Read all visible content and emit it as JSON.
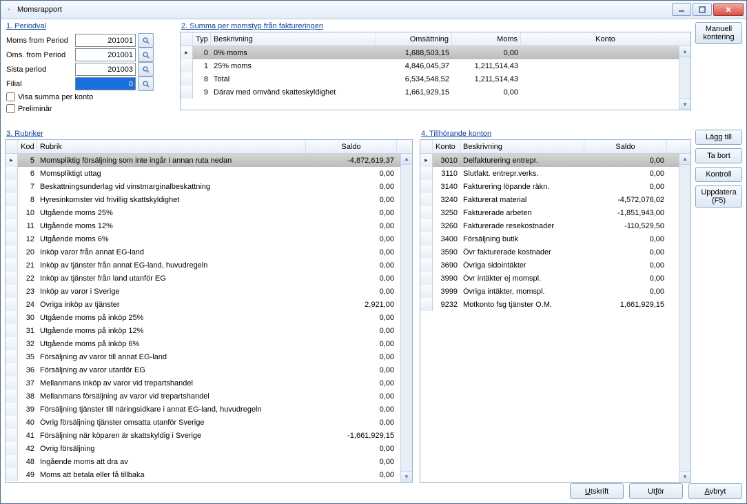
{
  "window": {
    "title": "Momsrapport"
  },
  "periodval": {
    "title": "1. Periodval",
    "moms_from_label": "Moms from Period",
    "moms_from": "201001",
    "oms_from_label": "Oms. from Period",
    "oms_from": "201001",
    "sista_label": "Sista period",
    "sista": "201003",
    "filial_label": "Filial",
    "filial": "0",
    "chk_visa": "Visa summa per konto",
    "chk_prelim": "Preliminär"
  },
  "summa": {
    "title": "2. Summa per momstyp från faktureringen",
    "head": {
      "typ": "Typ",
      "beskr": "Beskrivning",
      "oms": "Omsättning",
      "moms": "Moms",
      "konto": "Konto"
    },
    "rows": [
      {
        "typ": "0",
        "beskr": "0% moms",
        "oms": "1,688,503,15",
        "moms": "0,00",
        "sel": true
      },
      {
        "typ": "1",
        "beskr": "25% moms",
        "oms": "4,846,045,37",
        "moms": "1,211,514,43"
      },
      {
        "typ": "8",
        "beskr": "Total",
        "oms": "6,534,548,52",
        "moms": "1,211,514,43"
      },
      {
        "typ": "9",
        "beskr": "Därav med omvänd skatteskyldighet",
        "oms": "1,661,929,15",
        "moms": "0,00"
      }
    ]
  },
  "manuell": "Manuell\nkontering",
  "rubriker": {
    "title": "3. Rubriker",
    "head": {
      "kod": "Kod",
      "rubrik": "Rubrik",
      "saldo": "Saldo"
    },
    "rows": [
      {
        "kod": "5",
        "rubrik": "Momspliktig försäljning som inte ingår i annan ruta nedan",
        "saldo": "-4,872,619,37",
        "sel": true
      },
      {
        "kod": "6",
        "rubrik": "Momspliktigt uttag",
        "saldo": "0,00"
      },
      {
        "kod": "7",
        "rubrik": "Beskattningsunderlag vid vinstmarginalbeskattning",
        "saldo": "0,00"
      },
      {
        "kod": "8",
        "rubrik": "Hyresinkomster vid frivillig skattskyldighet",
        "saldo": "0,00"
      },
      {
        "kod": "10",
        "rubrik": "Utgående moms 25%",
        "saldo": "0,00"
      },
      {
        "kod": "11",
        "rubrik": "Utgående moms 12%",
        "saldo": "0,00"
      },
      {
        "kod": "12",
        "rubrik": "Utgående moms 6%",
        "saldo": "0,00"
      },
      {
        "kod": "20",
        "rubrik": "Inköp varor från annat EG-land",
        "saldo": "0,00"
      },
      {
        "kod": "21",
        "rubrik": "Inköp av tjänster från annat EG-land, huvudregeln",
        "saldo": "0,00"
      },
      {
        "kod": "22",
        "rubrik": "Inköp av tjänster från land utanför EG",
        "saldo": "0,00"
      },
      {
        "kod": "23",
        "rubrik": "Inköp av varor i Sverige",
        "saldo": "0,00"
      },
      {
        "kod": "24",
        "rubrik": "Övriga inköp av tjänster",
        "saldo": "2,921,00"
      },
      {
        "kod": "30",
        "rubrik": "Utgående moms på inköp 25%",
        "saldo": "0,00"
      },
      {
        "kod": "31",
        "rubrik": "Utgående moms på inköp 12%",
        "saldo": "0,00"
      },
      {
        "kod": "32",
        "rubrik": "Utgående moms på inköp 6%",
        "saldo": "0,00"
      },
      {
        "kod": "35",
        "rubrik": "Försäljning av varor till annat EG-land",
        "saldo": "0,00"
      },
      {
        "kod": "36",
        "rubrik": "Försäljning av varor utanför EG",
        "saldo": "0,00"
      },
      {
        "kod": "37",
        "rubrik": "Mellanmans inköp av varor vid trepartshandel",
        "saldo": "0,00"
      },
      {
        "kod": "38",
        "rubrik": "Mellanmans försäljning av varor vid trepartshandel",
        "saldo": "0,00"
      },
      {
        "kod": "39",
        "rubrik": "Försäljning tjänster till näringsidkare i annat EG-land, huvudregeln",
        "saldo": "0,00"
      },
      {
        "kod": "40",
        "rubrik": "Övrig försäljning tjänster omsatta utanför Sverige",
        "saldo": "0,00"
      },
      {
        "kod": "41",
        "rubrik": "Försäljning när köparen är skattskyldig i Sverige",
        "saldo": "-1,661,929,15"
      },
      {
        "kod": "42",
        "rubrik": "Övrig försäljning",
        "saldo": "0,00"
      },
      {
        "kod": "48",
        "rubrik": "Ingående moms att dra av",
        "saldo": "0,00"
      },
      {
        "kod": "49",
        "rubrik": "Moms att betala eller få tillbaka",
        "saldo": "0,00"
      }
    ]
  },
  "konton": {
    "title": "4. Tillhörande konton",
    "head": {
      "konto": "Konto",
      "beskr": "Beskrivning",
      "saldo": "Saldo"
    },
    "rows": [
      {
        "konto": "3010",
        "beskr": "Delfakturering entrepr.",
        "saldo": "0,00",
        "sel": true
      },
      {
        "konto": "3110",
        "beskr": "Slutfakt. entrepr.verks.",
        "saldo": "0,00"
      },
      {
        "konto": "3140",
        "beskr": "Fakturering löpande räkn.",
        "saldo": "0,00"
      },
      {
        "konto": "3240",
        "beskr": "Fakturerat material",
        "saldo": "-4,572,076,02"
      },
      {
        "konto": "3250",
        "beskr": "Fakturerade arbeten",
        "saldo": "-1,851,943,00"
      },
      {
        "konto": "3260",
        "beskr": "Fakturerade resekostnader",
        "saldo": "-110,529,50"
      },
      {
        "konto": "3400",
        "beskr": "Försäljning butik",
        "saldo": "0,00"
      },
      {
        "konto": "3590",
        "beskr": "Övr fakturerade kostnader",
        "saldo": "0,00"
      },
      {
        "konto": "3690",
        "beskr": "Övriga sidointäkter",
        "saldo": "0,00"
      },
      {
        "konto": "3990",
        "beskr": "Övr intäkter ej momspl.",
        "saldo": "0,00"
      },
      {
        "konto": "3999",
        "beskr": "Övriga intäkter, momspl.",
        "saldo": "0,00"
      },
      {
        "konto": "9232",
        "beskr": "Motkonto fsg tjänster O.M.",
        "saldo": "1,661,929,15"
      }
    ]
  },
  "sidebtns": {
    "lagg": "Lägg till",
    "tabort": "Ta bort",
    "kontroll": "Kontroll",
    "uppdatera": "Uppdatera\n(F5)"
  },
  "bottom": {
    "utskrift": "Utskrift",
    "utfor": "Utför",
    "avbryt": "Avbryt"
  }
}
